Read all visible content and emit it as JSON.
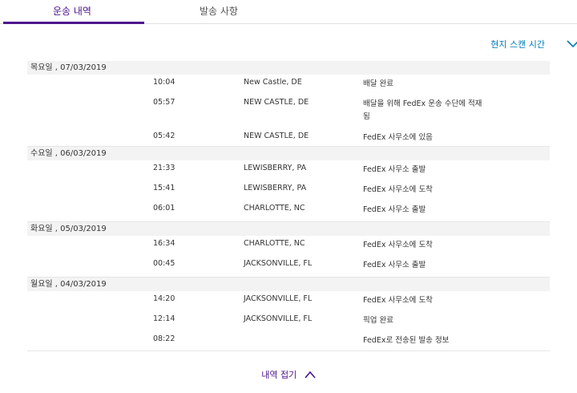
{
  "tabs": [
    {
      "label": "운송 내역",
      "active": true
    },
    {
      "label": "발송 사항",
      "active": false
    }
  ],
  "sort_label": "현지 스캔 시간",
  "collapse_label": "내역 접기",
  "colors": {
    "accent": "#4d148c",
    "link": "#007ab7"
  },
  "groups": [
    {
      "date": "목요일 , 07/03/2019",
      "events": [
        {
          "time": "10:04",
          "location": "New Castle, DE",
          "status": "배달 완료"
        },
        {
          "time": "05:57",
          "location": "NEW CASTLE, DE",
          "status": "배달을 위해 FedEx 운송 수단에 적재됨"
        },
        {
          "time": "05:42",
          "location": "NEW CASTLE, DE",
          "status": "FedEx 사무소에 있음"
        }
      ]
    },
    {
      "date": "수요일 , 06/03/2019",
      "events": [
        {
          "time": "21:33",
          "location": "LEWISBERRY, PA",
          "status": "FedEx 사무소 출발"
        },
        {
          "time": "15:41",
          "location": "LEWISBERRY, PA",
          "status": "FedEx 사무소에 도착"
        },
        {
          "time": "06:01",
          "location": "CHARLOTTE, NC",
          "status": "FedEx 사무소 출발"
        }
      ]
    },
    {
      "date": "화요일 , 05/03/2019",
      "events": [
        {
          "time": "16:34",
          "location": "CHARLOTTE, NC",
          "status": "FedEx 사무소에 도착"
        },
        {
          "time": "00:45",
          "location": "JACKSONVILLE, FL",
          "status": "FedEx 사무소 출발"
        }
      ]
    },
    {
      "date": "월요일 , 04/03/2019",
      "events": [
        {
          "time": "14:20",
          "location": "JACKSONVILLE, FL",
          "status": "FedEx 사무소에 도착"
        },
        {
          "time": "12:14",
          "location": "JACKSONVILLE, FL",
          "status": "픽업 완료"
        },
        {
          "time": "08:22",
          "location": "",
          "status": "FedEx로 전송된 발송 정보"
        }
      ]
    }
  ]
}
